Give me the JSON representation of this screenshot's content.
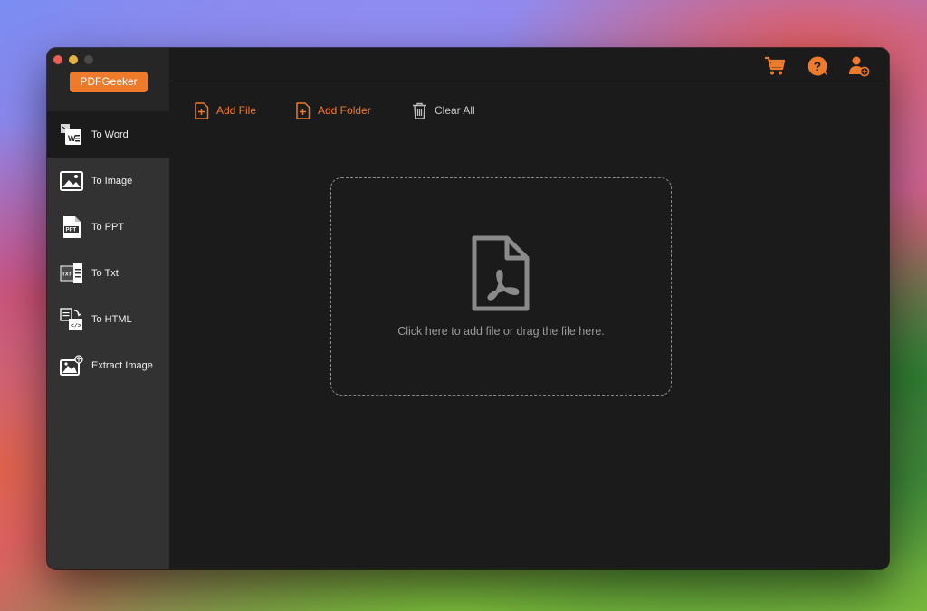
{
  "app": {
    "brand": "PDFGeeker"
  },
  "header": {
    "icons": [
      {
        "name": "cart-icon",
        "color": "#ee7a2b"
      },
      {
        "name": "help-icon",
        "color": "#ee7a2b"
      },
      {
        "name": "account-icon",
        "color": "#ee7a2b"
      }
    ]
  },
  "sidebar": {
    "items": [
      {
        "label": "To Word",
        "icon": "word-icon",
        "active": true
      },
      {
        "label": "To Image",
        "icon": "image-icon",
        "active": false
      },
      {
        "label": "To PPT",
        "icon": "ppt-icon",
        "active": false
      },
      {
        "label": "To Txt",
        "icon": "txt-icon",
        "active": false
      },
      {
        "label": "To HTML",
        "icon": "html-icon",
        "active": false
      },
      {
        "label": "Extract Image",
        "icon": "extract-image-icon",
        "active": false
      }
    ]
  },
  "toolbar": {
    "add_file": "Add File",
    "add_folder": "Add Folder",
    "clear_all": "Clear All"
  },
  "dropzone": {
    "icon": "pdf-file-icon",
    "text": "Click here to add file or drag the file here."
  },
  "colors": {
    "accent": "#ee7a2b",
    "window_bg": "#1b1b1b",
    "sidebar_bg": "#323232"
  }
}
